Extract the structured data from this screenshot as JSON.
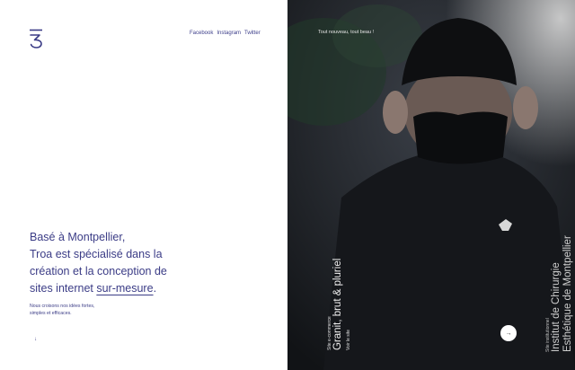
{
  "social": {
    "links": [
      "Facebook",
      "Instagram",
      "Twitter"
    ]
  },
  "hero": {
    "line1": "Basé à Montpellier,",
    "line2": "Troa est spécialisé dans la",
    "line3": "création et la conception de",
    "line4_prefix": "sites internet ",
    "line4_highlight": "sur-mesure",
    "line4_suffix": ".",
    "sub_line1": "Nous croisons nos idées fortes,",
    "sub_line2": "simples et efficaces."
  },
  "right_panel": {
    "tagline": "Tout nouveau, tout beau !",
    "project1": {
      "category": "Site e-commerce",
      "title": "Granit, brut & pluriel",
      "link": "Voir le site"
    },
    "project2": {
      "category": "Site institutionnel",
      "title_line1": "Institut de Chirurgie",
      "title_line2": "Esthétique de Montpellier"
    }
  },
  "icons": {
    "logo": "troa-logo-icon",
    "down": "arrow-down-icon",
    "next": "arrow-right-icon"
  },
  "colors": {
    "brand": "#3b3c86",
    "photo_bg": "#1a1d22"
  }
}
